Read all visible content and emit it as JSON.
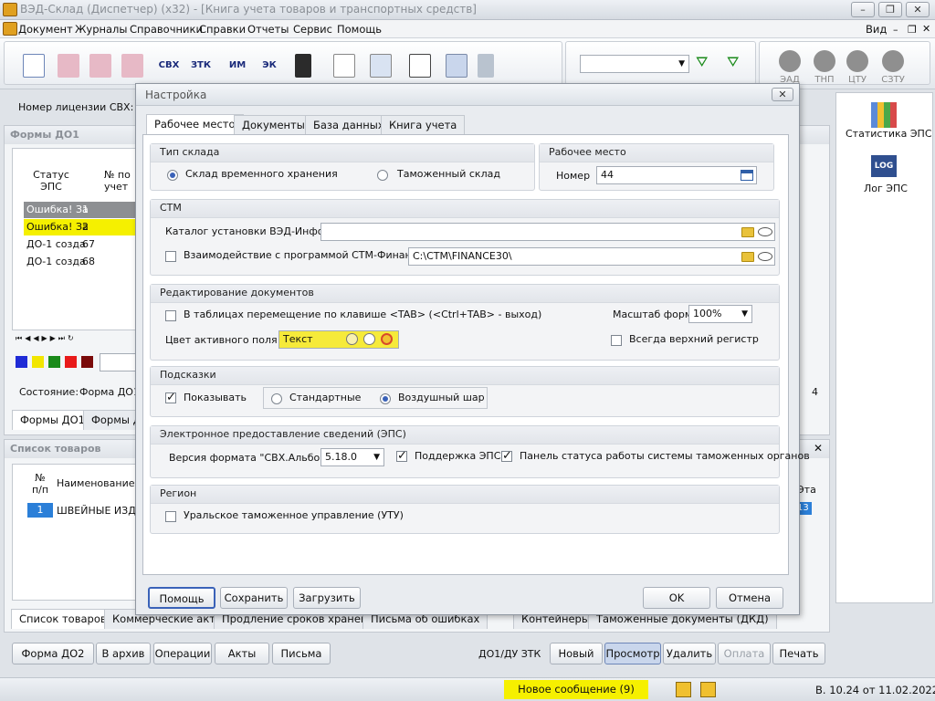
{
  "window": {
    "title": "ВЭД-Склад (Диспетчер) (x32) - [Книга учета товаров и транспортных средств]",
    "view_label": "Вид"
  },
  "menu": [
    "Документ",
    "Журналы",
    "Справочники",
    "Справки",
    "Отчеты",
    "Сервис",
    "Помощь"
  ],
  "toolbar": {
    "text_buttons": [
      "СВХ",
      "ЗТК",
      "ИМ",
      "ЭК"
    ],
    "indicators": [
      "ЭАД",
      "ТНП",
      "ЦТУ",
      "СЗТУ"
    ]
  },
  "right_panel": {
    "stat_label": "Статистика ЭПС",
    "log_label": "Лог ЭПС",
    "log_icon_text": "LOG"
  },
  "license_label": "Номер лицензии СВХ:",
  "forms_panel": {
    "title": "Формы ДО1",
    "col_status": "Статус ЭПС",
    "col_num": "№ по учет",
    "rows": [
      {
        "status": "Ошибка! За",
        "num": "1"
      },
      {
        "status": "Ошибка! За",
        "num": "2"
      },
      {
        "status": "ДО-1 созда",
        "num": "67"
      },
      {
        "status": "ДО-1 созда",
        "num": "68"
      }
    ],
    "state_label": "Состояние:",
    "state_value": "Форма ДО1",
    "tabs": [
      "Формы ДО1",
      "Формы Д"
    ],
    "right_num": "4",
    "colors": [
      "#1f2bd6",
      "#f2e600",
      "#1a8a1a",
      "#e81a1a",
      "#7a0a0a"
    ]
  },
  "goods_panel": {
    "title": "Список товаров",
    "col_num": "№ п/п",
    "col_name": "Наименование т",
    "row_num": "1",
    "row_name": "ШВЕЙНЫЕ ИЗДЕ",
    "right_col": "Эта",
    "right_val": "13"
  },
  "bottom_tabs": [
    "Список товаров",
    "Коммерческие акты",
    "Продление сроков хранения",
    "Письма об ошибках"
  ],
  "bottom_tabs_right": [
    "Контейнеры",
    "Таможенные документы (ДКД)"
  ],
  "bottom_buttons_left": [
    "Форма ДО2",
    "В архив",
    "Операции",
    "Акты",
    "Письма"
  ],
  "bottom_section_label": "ДО1/ДУ ЗТК",
  "bottom_buttons_right": [
    "Новый",
    "Просмотр",
    "Удалить",
    "Оплата",
    "Печать"
  ],
  "status": {
    "message": "Новое сообщение (9)",
    "version": "В. 10.24 от 11.02.2022"
  },
  "dialog": {
    "title": "Настройка",
    "tabs": [
      "Рабочее место",
      "Документы",
      "База данных",
      "Книга учета"
    ],
    "warehouse": {
      "title": "Тип склада",
      "opt1": "Склад временного хранения",
      "opt2": "Таможенный склад",
      "selected": "opt1"
    },
    "workplace": {
      "title": "Рабочее место",
      "num_label": "Номер",
      "num_value": "44"
    },
    "ctm": {
      "title": "СТМ",
      "catalog_label": "Каталог установки ВЭД-Инфо",
      "catalog_value": "",
      "interop_label": "Взаимодействие с программой СТМ-Финансы",
      "interop_checked": false,
      "interop_path": "C:\\CTM\\FINANCE30\\"
    },
    "editing": {
      "title": "Редактирование документов",
      "tab_label": "В таблицах перемещение по клавише <TAB> (<Ctrl+TAB> - выход)",
      "tab_checked": false,
      "scale_label": "Масштаб форм",
      "scale_value": "100%",
      "color_label": "Цвет активного поля",
      "color_sample": "Текст",
      "active_color": "#f6ea3a",
      "upper_label": "Всегда верхний регистр",
      "upper_checked": false
    },
    "hints": {
      "title": "Подсказки",
      "show_label": "Показывать",
      "show_checked": true,
      "std": "Стандартные",
      "balloon": "Воздушный шар",
      "selected": "balloon"
    },
    "eps": {
      "title": "Электронное предоставление сведений (ЭПС)",
      "version_label": "Версия формата \"СВХ.Альбом\"",
      "version_value": "5.18.0",
      "support_label": "Поддержка ЭПС",
      "support_checked": true,
      "panel_label": "Панель статуса работы системы таможенных органов",
      "panel_checked": true
    },
    "region": {
      "title": "Регион",
      "ural_label": "Уральское таможенное управление (УТУ)",
      "ural_checked": false
    },
    "buttons": {
      "help": "Помощь",
      "save": "Сохранить",
      "load": "Загрузить",
      "ok": "OK",
      "cancel": "Отмена"
    }
  }
}
